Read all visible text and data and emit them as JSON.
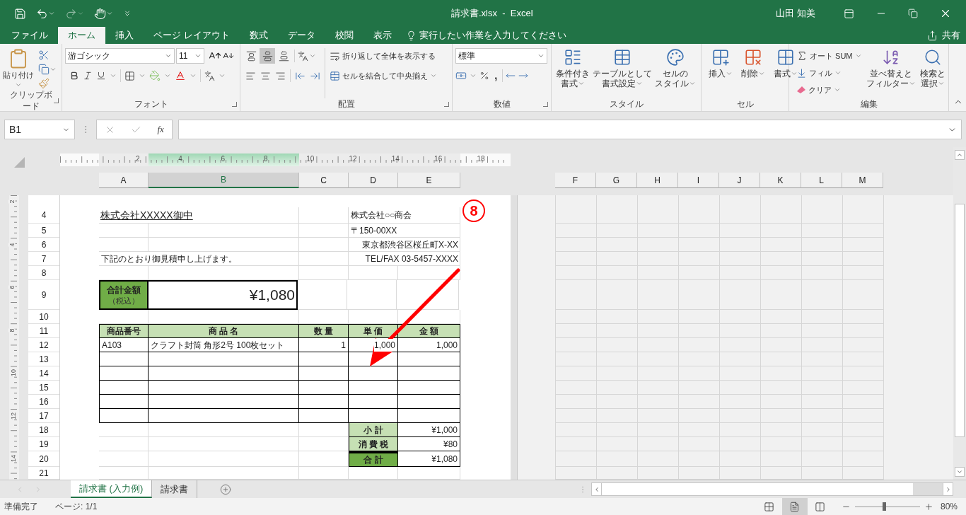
{
  "title_bar": {
    "title": "請求書.xlsx  -  Excel",
    "user": "山田 知美"
  },
  "menu_tabs": [
    {
      "label": "ファイル",
      "selected": false
    },
    {
      "label": "ホーム",
      "selected": true
    },
    {
      "label": "挿入",
      "selected": false
    },
    {
      "label": "ページ レイアウト",
      "selected": false
    },
    {
      "label": "数式",
      "selected": false
    },
    {
      "label": "データ",
      "selected": false
    },
    {
      "label": "校閲",
      "selected": false
    },
    {
      "label": "表示",
      "selected": false
    }
  ],
  "tell_me": "実行したい作業を入力してください",
  "share": "共有",
  "ribbon": {
    "groups": [
      {
        "kind": "clipboard",
        "label": "クリップボード",
        "launcher": true,
        "paste": "貼り付け"
      },
      {
        "kind": "font",
        "label": "フォント",
        "launcher": true,
        "font_name": "游ゴシック",
        "font_size": "11"
      },
      {
        "kind": "alignment",
        "label": "配置",
        "launcher": true,
        "wrap_text": "折り返して全体を表示する",
        "merge": "セルを結合して中央揃え",
        "vertical_buttons": [
          {
            "selected": false
          },
          {
            "selected": true
          },
          {
            "selected": false
          }
        ]
      },
      {
        "kind": "number",
        "label": "数値",
        "launcher": true,
        "format": "標準",
        "comma": ","
      },
      {
        "kind": "styles",
        "label": "スタイル",
        "launcher": false,
        "buttons": [
          [
            "条件付き",
            "書式"
          ],
          [
            "テーブルとして",
            "書式設定"
          ],
          [
            "セルの",
            "スタイル"
          ]
        ]
      },
      {
        "kind": "cells",
        "label": "セル",
        "launcher": false,
        "buttons": [
          "挿入",
          "削除",
          "書式"
        ]
      },
      {
        "kind": "editing",
        "label": "編集",
        "launcher": false,
        "autosum": "オート SUM",
        "fill": "フィル",
        "clear": "クリア",
        "sort": [
          "並べ替えと",
          "フィルター"
        ],
        "find": [
          "検索と",
          "選択"
        ]
      }
    ]
  },
  "formula_bar": {
    "name_box": "B1",
    "function_button": "fx"
  },
  "ruler_marks": [
    "2",
    "4",
    "6",
    "8",
    "10",
    "12",
    "14",
    "16",
    "18"
  ],
  "vertical_ruler_marks": [
    "2",
    "4",
    "6",
    "8",
    "10",
    "12",
    "14"
  ],
  "columns": [
    {
      "label": "A",
      "selected": false
    },
    {
      "label": "B",
      "selected": true
    },
    {
      "label": "C",
      "selected": false
    },
    {
      "label": "D",
      "selected": false
    },
    {
      "label": "E",
      "selected": false
    },
    {
      "label": "F",
      "selected": false
    },
    {
      "label": "G",
      "selected": false
    },
    {
      "label": "H",
      "selected": false
    },
    {
      "label": "I",
      "selected": false
    },
    {
      "label": "J",
      "selected": false
    },
    {
      "label": "K",
      "selected": false
    },
    {
      "label": "L",
      "selected": false
    },
    {
      "label": "M",
      "selected": false
    }
  ],
  "rows": [
    {
      "number": "4",
      "cells": [
        {
          "kind": "title",
          "text": "株式会社XXXXX御中"
        },
        {
          "kind": "empty"
        },
        {
          "kind": "empty"
        },
        {
          "kind": "small",
          "text": "株式会社○○商会"
        },
        {
          "kind": "empty"
        }
      ]
    },
    {
      "number": "5",
      "cells": [
        {
          "kind": "empty"
        },
        {
          "kind": "empty"
        },
        {
          "kind": "empty"
        },
        {
          "kind": "small",
          "text": "〒150-00XX"
        },
        {
          "kind": "empty"
        }
      ]
    },
    {
      "number": "6",
      "cells": [
        {
          "kind": "empty"
        },
        {
          "kind": "empty"
        },
        {
          "kind": "empty"
        },
        {
          "kind": "empty"
        },
        {
          "kind": "small_right",
          "text": "東京都渋谷区桜丘町X-XX"
        }
      ]
    },
    {
      "number": "7",
      "cells": [
        {
          "kind": "small",
          "text": "下記のとおり御見積申し上げます。"
        },
        {
          "kind": "empty"
        },
        {
          "kind": "empty"
        },
        {
          "kind": "empty"
        },
        {
          "kind": "small_right",
          "text": "TEL/FAX 03-5457-XXXX"
        }
      ]
    },
    {
      "number": "8"
    },
    {
      "number": "9",
      "cells": [
        {
          "kind": "total_label",
          "text": "合計金額",
          "sub": "（税込）"
        },
        {
          "kind": "total_value",
          "text": "¥1,080"
        },
        {
          "kind": "empty"
        },
        {
          "kind": "empty"
        },
        {
          "kind": "empty"
        }
      ]
    },
    {
      "number": "10"
    },
    {
      "number": "11",
      "cells": [
        {
          "kind": "header",
          "text": "商品番号"
        },
        {
          "kind": "header",
          "text": "商 品 名"
        },
        {
          "kind": "header",
          "text": "数 量"
        },
        {
          "kind": "header",
          "text": "単 価"
        },
        {
          "kind": "header",
          "text": "金 額"
        }
      ]
    },
    {
      "number": "12",
      "cells": [
        {
          "kind": "item",
          "text": "A103"
        },
        {
          "kind": "item",
          "text": "クラフト封筒 角形2号 100枚セット"
        },
        {
          "kind": "item_number",
          "text": "1"
        },
        {
          "kind": "item_number",
          "text": "1,000"
        },
        {
          "kind": "item_number",
          "text": "1,000"
        }
      ]
    },
    {
      "number": "13",
      "cells": [
        {
          "kind": "item"
        },
        {
          "kind": "item"
        },
        {
          "kind": "item"
        },
        {
          "kind": "item"
        },
        {
          "kind": "item"
        }
      ]
    },
    {
      "number": "14",
      "cells": [
        {
          "kind": "item"
        },
        {
          "kind": "item"
        },
        {
          "kind": "item"
        },
        {
          "kind": "item"
        },
        {
          "kind": "item"
        }
      ]
    },
    {
      "number": "15",
      "cells": [
        {
          "kind": "item"
        },
        {
          "kind": "item"
        },
        {
          "kind": "item"
        },
        {
          "kind": "item"
        },
        {
          "kind": "item"
        }
      ]
    },
    {
      "number": "16",
      "cells": [
        {
          "kind": "item"
        },
        {
          "kind": "item"
        },
        {
          "kind": "item"
        },
        {
          "kind": "item"
        },
        {
          "kind": "item"
        }
      ]
    },
    {
      "number": "17",
      "cells": [
        {
          "kind": "item"
        },
        {
          "kind": "item"
        },
        {
          "kind": "item"
        },
        {
          "kind": "item"
        },
        {
          "kind": "item"
        }
      ]
    },
    {
      "number": "18",
      "cells": [
        {
          "kind": "empty"
        },
        {
          "kind": "empty"
        },
        {
          "kind": "empty"
        },
        {
          "kind": "sum_label",
          "text": "小 計"
        },
        {
          "kind": "item_number",
          "text": "¥1,000"
        }
      ]
    },
    {
      "number": "19",
      "cells": [
        {
          "kind": "empty"
        },
        {
          "kind": "empty"
        },
        {
          "kind": "empty"
        },
        {
          "kind": "sum_label",
          "text": "消 費 税"
        },
        {
          "kind": "item_number",
          "text": "¥80"
        }
      ]
    },
    {
      "number": "20",
      "cells": [
        {
          "kind": "empty"
        },
        {
          "kind": "empty"
        },
        {
          "kind": "empty"
        },
        {
          "kind": "sum_total",
          "text": "合 計"
        },
        {
          "kind": "item_number",
          "text": "¥1,080"
        }
      ]
    },
    {
      "number": "21"
    }
  ],
  "annotation": {
    "number": "8"
  },
  "sheet_tabs": [
    {
      "label": "請求書 (入力例)",
      "selected": true
    },
    {
      "label": "請求書",
      "selected": false
    }
  ],
  "status_bar": {
    "status": "準備完了",
    "page": "ページ: 1/1",
    "view_buttons": [
      {
        "selected": false
      },
      {
        "selected": true
      },
      {
        "selected": false
      }
    ],
    "zoom": {
      "level": 0.45
    },
    "zoom_text": "80%"
  }
}
